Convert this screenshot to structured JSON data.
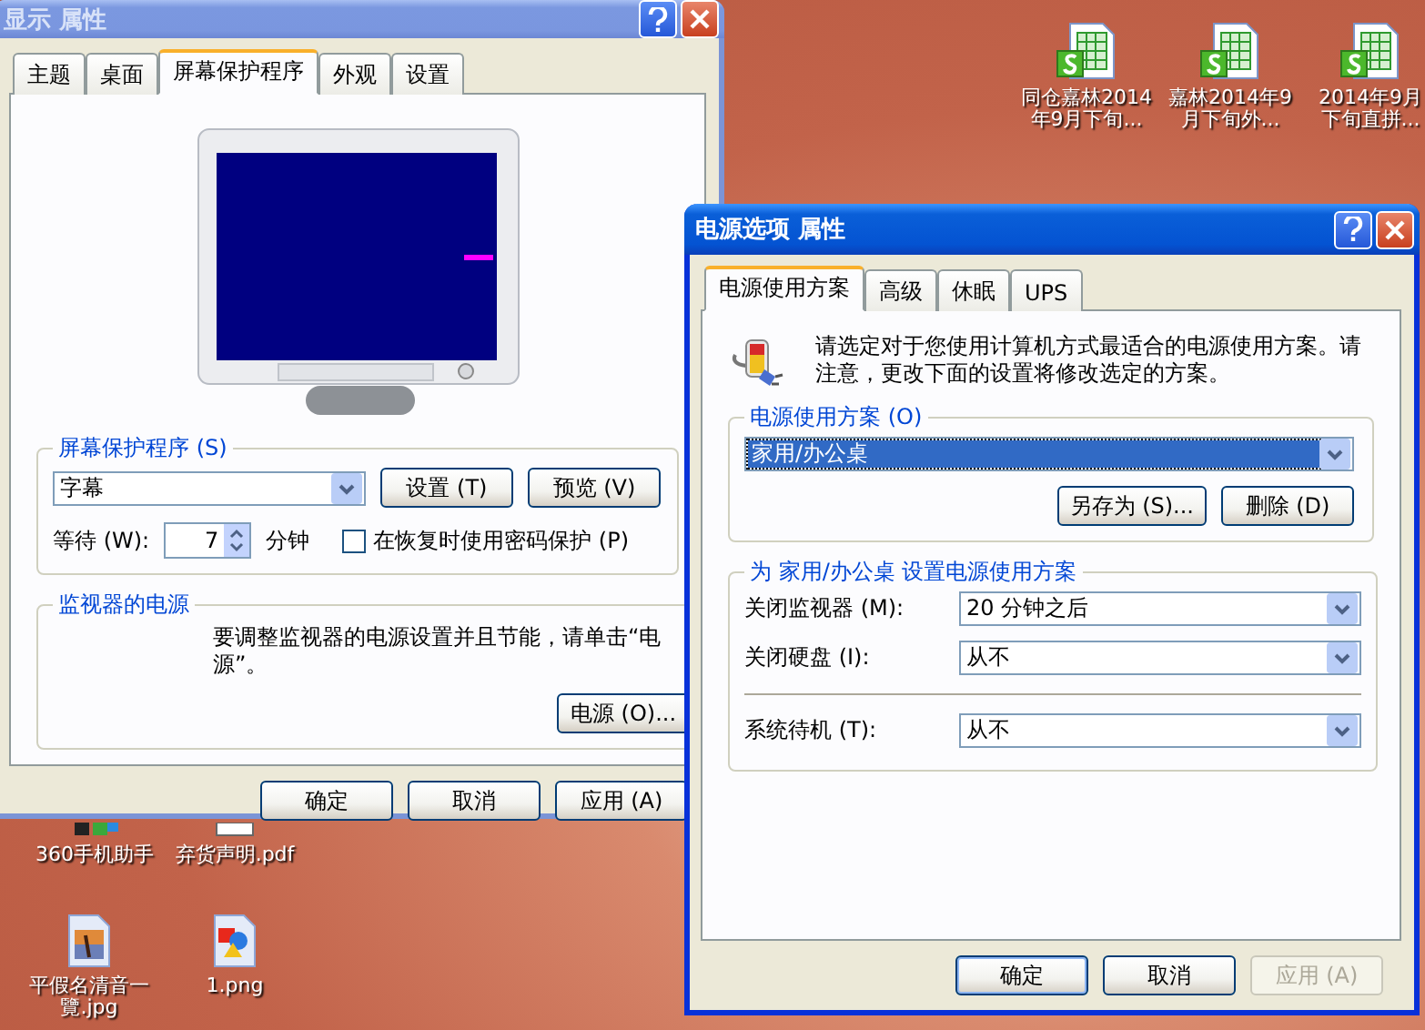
{
  "desktop_icons": [
    {
      "kind": "sheet",
      "lines": [
        "同仓嘉林2014",
        "年9月下旬..."
      ]
    },
    {
      "kind": "sheet",
      "lines": [
        "嘉林2014年9",
        "月下旬外..."
      ]
    },
    {
      "kind": "sheet",
      "lines": [
        "2014年9月",
        "下旬直拼..."
      ]
    },
    {
      "kind": "app",
      "lines": [
        "360手机助手"
      ]
    },
    {
      "kind": "pdf",
      "lines": [
        "弃货声明.pdf"
      ]
    },
    {
      "kind": "jpg",
      "lines": [
        "平假名清音一",
        "覽.jpg"
      ]
    },
    {
      "kind": "png",
      "lines": [
        "1.png"
      ]
    }
  ],
  "display_window": {
    "title": "显示 属性",
    "active": false,
    "tabs": [
      {
        "label": "主题",
        "selected": false
      },
      {
        "label": "桌面",
        "selected": false
      },
      {
        "label": "屏幕保护程序",
        "selected": true
      },
      {
        "label": "外观",
        "selected": false
      },
      {
        "label": "设置",
        "selected": false
      }
    ],
    "screensaver_group": {
      "title": "屏幕保护程序 (S)",
      "dropdown": {
        "value": "字幕",
        "focused": false
      },
      "buttons": [
        "设置 (T)",
        "预览 (V)"
      ],
      "wait_label": "等待 (W):",
      "wait_value": "7",
      "wait_unit": "分钟",
      "password": {
        "label": "在恢复时使用密码保护 (P)",
        "checked": false
      }
    },
    "monitor_power_group": {
      "title": "监视器的电源",
      "description": "要调整监视器的电源设置并且节能，请单击“电源”。",
      "button": "电源 (O)..."
    },
    "buttons": [
      {
        "label": "确定",
        "default": false,
        "disabled": false
      },
      {
        "label": "取消",
        "default": false,
        "disabled": false
      },
      {
        "label": "应用 (A)",
        "default": false,
        "disabled": false
      }
    ]
  },
  "power_window": {
    "title": "电源选项 属性",
    "active": true,
    "tabs": [
      {
        "label": "电源使用方案",
        "selected": true
      },
      {
        "label": "高级",
        "selected": false
      },
      {
        "label": "休眠",
        "selected": false
      },
      {
        "label": "UPS",
        "selected": false
      }
    ],
    "description": "请选定对于您使用计算机方式最适合的电源使用方案。请注意，更改下面的设置将修改选定的方案。",
    "scheme_group": {
      "title": "电源使用方案 (O)",
      "dropdown": {
        "value": "家用/办公桌",
        "focused": true
      },
      "buttons": [
        "另存为 (S)...",
        "删除 (D)"
      ]
    },
    "settings_group": {
      "title": "为 家用/办公桌 设置电源使用方案",
      "row_groups": [
        [
          {
            "label": "关闭监视器 (M):",
            "value": "20 分钟之后"
          },
          {
            "label": "关闭硬盘 (I):",
            "value": "从不"
          }
        ],
        [
          {
            "label": "系统待机 (T):",
            "value": "从不"
          }
        ]
      ]
    },
    "buttons": [
      {
        "label": "确定",
        "default": true,
        "disabled": false
      },
      {
        "label": "取消",
        "default": false,
        "disabled": false
      },
      {
        "label": "应用 (A)",
        "default": false,
        "disabled": true
      }
    ]
  }
}
